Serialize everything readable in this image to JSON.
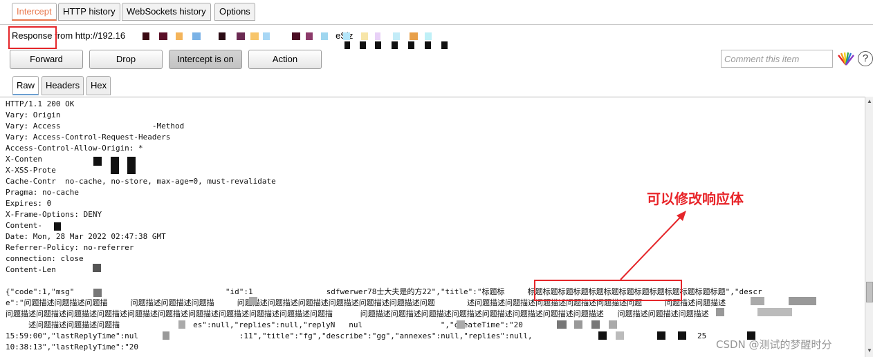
{
  "tabs": [
    {
      "label": "Intercept",
      "active": true
    },
    {
      "label": "HTTP history"
    },
    {
      "label": "WebSockets history"
    },
    {
      "label": "Options"
    }
  ],
  "response_info": {
    "prefix": "Response",
    "text": " from http://192.16",
    "tail": "eSiz"
  },
  "toolbar": {
    "forward": "Forward",
    "drop": "Drop",
    "intercept": "Intercept is on",
    "action": "Action"
  },
  "comment": {
    "placeholder": "Comment this item"
  },
  "help": "?",
  "subtabs": [
    {
      "label": "Raw",
      "active": true
    },
    {
      "label": "Headers"
    },
    {
      "label": "Hex"
    }
  ],
  "response_lines": [
    "HTTP/1.1 200 OK",
    "Vary: Origin",
    "Vary: Access                    -Method",
    "Vary: Access-Control-Request-Headers",
    "Access-Control-Allow-Origin: *",
    "X-Conten",
    "X-XSS-Prote",
    "Cache-Contr  no-cache, no-store, max-age=0, must-revalidate",
    "Pragma: no-cache",
    "Expires: 0",
    "X-Frame-Options: DENY",
    "Content-",
    "Date: Mon, 28 Mar 2022 02:47:38 GMT",
    "Referrer-Policy: no-referrer",
    "connection: close",
    "Content-Len",
    "",
    "{\"code\":1,\"msg\"                                 \"id\":1                sdfwerwer78士大夫是的方22\",\"title\":\"标题标     标题标题标题标题标题标题标题标题标题标题标题标题标题\",\"descr",
    "e\":\"问题描述问题描述问题描     问题描述问题描述问题描     问题描述问题描述问题描述问题描述问题描述问题描述问题       述问题描述问题描述问题描述问题描述问题描述问题     问题描述问题描述",
    "问题描述问题描述问题描述问题描述问题描述问题描述问题描述问题描述问题描述问题描述问题描      问题描述问题描述问题描述问题描述问题描述问题描述问题描述问题描述   问题描述问题描述问题描述",
    "     述问题描述问题描述问题描                es\":null,\"replies\":null,\"replyN   nul                 \",\"createTime\":\"20",
    "15:59:00\",\"lastReplyTime\":nul                      :11\",\"title\":\"fg\",\"describe\":\"gg\",\"annexes\":null,\"replies\":null,                                    25",
    "10:38:13\",\"lastReplyTime\":\"20"
  ],
  "annotation": "可以修改响应体",
  "watermark": "CSDN @测试的梦醒时分",
  "colors": {
    "accent": "#e8764a",
    "annotation_red": "#e5262a"
  }
}
